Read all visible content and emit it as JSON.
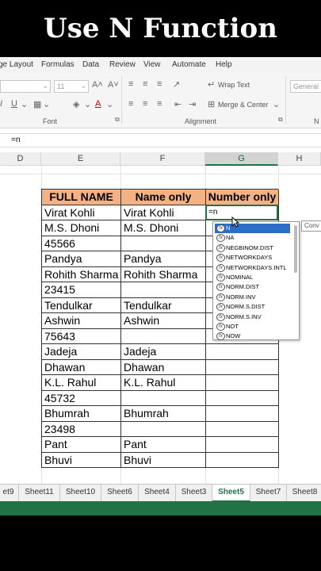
{
  "video_title": "Use N Function",
  "menu": [
    "ge Layout",
    "Formulas",
    "Data",
    "Review",
    "View",
    "Automate",
    "Help"
  ],
  "ribbon": {
    "font_size": "11",
    "wrap_text": "Wrap Text",
    "merge_center": "Merge & Center",
    "number_format": "General",
    "font_group": "Font",
    "alignment_group": "Alignment",
    "number_group_fragment": "N"
  },
  "formula_bar": {
    "content": "=n"
  },
  "columns": [
    "D",
    "E",
    "F",
    "G",
    "H"
  ],
  "table": {
    "headers": [
      "FULL NAME",
      "Name only",
      "Number only"
    ],
    "rows": [
      [
        "Virat Kohli",
        "Virat Kohli"
      ],
      [
        "M.S. Dhoni",
        "M.S. Dhoni"
      ],
      [
        "45566",
        ""
      ],
      [
        "Pandya",
        "Pandya"
      ],
      [
        "Rohith Sharma",
        "Rohith Sharma"
      ],
      [
        "23415",
        ""
      ],
      [
        "Tendulkar",
        "Tendulkar"
      ],
      [
        " Ashwin",
        " Ashwin"
      ],
      [
        "75643",
        ""
      ],
      [
        "Jadeja",
        "Jadeja"
      ],
      [
        "Dhawan",
        "Dhawan"
      ],
      [
        "K.L. Rahul",
        "K.L. Rahul"
      ],
      [
        "45732",
        ""
      ],
      [
        "Bhumrah",
        "Bhumrah"
      ],
      [
        "23498",
        ""
      ],
      [
        "Pant",
        "Pant"
      ],
      [
        "Bhuvi",
        "Bhuvi"
      ]
    ]
  },
  "active_cell_value": "=n",
  "autocomplete": [
    "N",
    "NA",
    "NEGBINOM.DIST",
    "NETWORKDAYS",
    "NETWORKDAYS.INTL",
    "NOMINAL",
    "NORM.DIST",
    "NORM.INV",
    "NORM.S.DIST",
    "NORM.S.INV",
    "NOT",
    "NOW"
  ],
  "tooltip_fragment": "Conv",
  "sheet_tabs": [
    "et9",
    "Sheet11",
    "Sheet10",
    "Sheet6",
    "Sheet4",
    "Sheet3",
    "Sheet5",
    "Sheet7",
    "Sheet8"
  ],
  "active_sheet": "Sheet5",
  "colors": {
    "header_fill": "#f4b183",
    "excel_green": "#217346",
    "selected_item": "#2b6ec9"
  }
}
